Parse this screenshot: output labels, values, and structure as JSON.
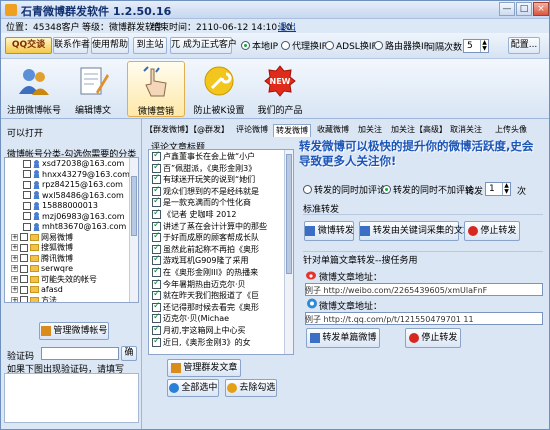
{
  "app": {
    "title": "石青微博群发软件 1.2.50.16"
  },
  "window_buttons": {
    "minimize": "—",
    "maximize": "□",
    "close": "×"
  },
  "info": {
    "position": "位置：45348客户",
    "level": "等级：微博群发软件",
    "expiry": "结束时间：2110-06-12 14:10:10",
    "exit": "退出"
  },
  "toolbar": {
    "qq_label": "QQ交谈",
    "contact": "联系作者",
    "help": "使用帮助",
    "home": "到主站",
    "upgrade": "兀 成为正式客户",
    "ip_options": [
      {
        "label": "本地IP",
        "checked": true
      },
      {
        "label": "代理换IP",
        "checked": false
      },
      {
        "label": "ADSL换IP",
        "checked": false
      },
      {
        "label": "路由器换IP",
        "checked": false
      }
    ],
    "interval_label": "间隔次数",
    "interval_value": "5",
    "config": "配置..."
  },
  "ribbon": [
    {
      "label": "注册微博帐号",
      "icon": "users-icon"
    },
    {
      "label": "编辑博文",
      "icon": "edit-doc-icon"
    },
    {
      "label": "微博营销",
      "icon": "hand-pointer-icon",
      "active": true
    },
    {
      "label": "防止被K设置",
      "icon": "wrench-icon"
    },
    {
      "label": "我们的产品",
      "icon": "new-badge-icon"
    }
  ],
  "left": {
    "open_label": "可以打开",
    "accounts_label": "微博帐号分类-勾选你需要的分类",
    "tree": [
      {
        "text": "xsd72038@163.com",
        "type": "account",
        "indent": 2
      },
      {
        "text": "hnxx43279@163.com",
        "type": "account",
        "indent": 2
      },
      {
        "text": "rpz84215@163.com",
        "type": "account",
        "indent": 2
      },
      {
        "text": "wxl58486@163.com",
        "type": "account",
        "indent": 2
      },
      {
        "text": "15888000013",
        "type": "account",
        "indent": 2
      },
      {
        "text": "mzj06983@163.com",
        "type": "account",
        "indent": 2
      },
      {
        "text": "mht83670@163.com",
        "type": "account",
        "indent": 2
      },
      {
        "text": "网易微博",
        "type": "folder",
        "indent": 1
      },
      {
        "text": "搜狐微博",
        "type": "folder",
        "indent": 1
      },
      {
        "text": "腾讯微博",
        "type": "folder",
        "indent": 1
      },
      {
        "text": "serwqre",
        "type": "folder",
        "indent": 1
      },
      {
        "text": "可能失效的帐号",
        "type": "folder",
        "indent": 1
      },
      {
        "text": "afasd",
        "type": "folder",
        "indent": 1
      },
      {
        "text": "方法",
        "type": "folder",
        "indent": 1
      },
      {
        "text": "方法这里",
        "type": "folder",
        "indent": 1
      }
    ],
    "manage_accounts": "管理微博帐号",
    "captcha_label": "验证码",
    "captcha_btn": "确",
    "captcha_hint": "如果下图出现验证码，请填写"
  },
  "tabs": [
    "【群发微博】",
    "【@群发】",
    "评论微博",
    "转发微博",
    "收藏微博",
    "加关注",
    "加关注【高级】",
    "取消关注",
    "上传头像"
  ],
  "active_tab": "转发微博",
  "middle": {
    "list_header": "评论文章标题",
    "articles": [
      "卢鑫董事长在会上做“小户",
      "百”佩甜派，《奥形金刚3》",
      "有球迷开玩笑的说到“她们",
      "观众们想到的不是经纬就是",
      "是一款充满而的个性化商",
      "《记者 史咖啡 2012",
      "讲述了蒸在会计计算中的那些",
      "于好而成原的顾客帮成长队",
      "虽然此前起称不再拍《奥形",
      "游戏耳机G909隆了采用",
      "在《奥形金刚III》的热播来",
      "今年暑期热由迈克尔·贝",
      "就在昨天我们抱报道了《巨",
      "还记得那时候去看完《奥形",
      "迈克尔·贝(Michae",
      "月初,宇这箱网上中心买",
      "近日,《奥形金刚3》的女"
    ],
    "manage_articles": "管理群发文章",
    "select_all": "全部选中",
    "deselect": "去除勾选"
  },
  "right": {
    "banner": "转发微博可以极快的提升你的微博活跃度,史会导致更多人关注你!",
    "opt_comment_same": "转发的同时加评论",
    "opt_comment_none": "转发的同时不加评论",
    "repost_count_label": "转发",
    "repost_count_value": "1",
    "repost_count_unit": "次",
    "section_label": "标准转发",
    "btn_repost": "微博转发",
    "btn_repost_keyword": "转发由关键词采集的文章",
    "btn_stop": "停止转发",
    "single_label": "针对单篇文章转发--搜任务用",
    "sina_addr_label": "微博文章地址：",
    "example1": "例子 http://weibo.com/2265439605/xmUlaFnF",
    "qq_addr_label": "微博文章地址：",
    "example2": "例子 http://t.qq.com/p/t/121550479701 11",
    "btn_repost_single": "转发单篇微博",
    "btn_stop2": "停止转发"
  }
}
